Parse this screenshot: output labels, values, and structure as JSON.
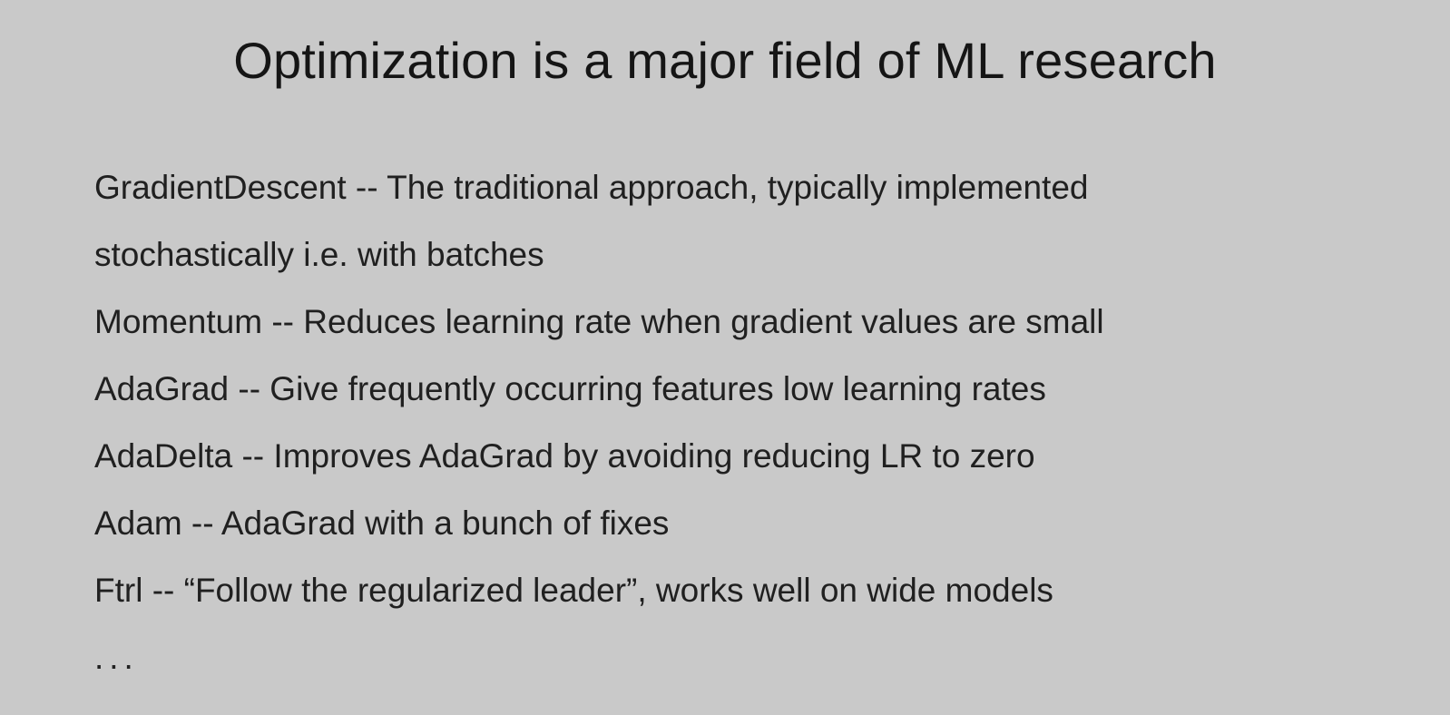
{
  "slide": {
    "title": "Optimization is a major field of ML research",
    "lines": [
      "GradientDescent -- The traditional approach, typically implemented",
      "stochastically i.e. with batches",
      "Momentum -- Reduces learning rate when gradient values are small",
      "AdaGrad -- Give frequently occurring features low learning rates",
      "AdaDelta -- Improves AdaGrad by avoiding reducing LR to zero",
      "Adam -- AdaGrad with a bunch of fixes",
      "Ftrl -- “Follow the regularized leader”, works well on wide models"
    ],
    "ellipsis": "..."
  },
  "colors": {
    "background": "#c9c9c9",
    "text": "#202020"
  }
}
